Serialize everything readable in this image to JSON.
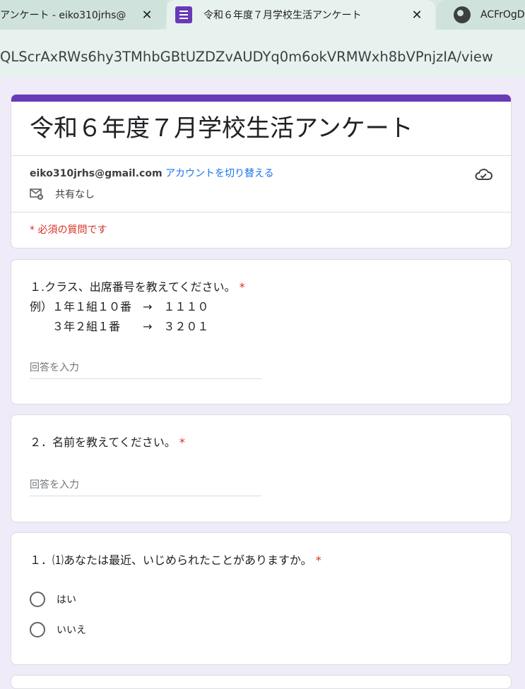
{
  "browser": {
    "tabs": [
      {
        "title": "アンケート - eiko310jrhs@",
        "close": "✕"
      },
      {
        "title": "令和６年度７月学校生活アンケート",
        "close": "✕"
      },
      {
        "title": "ACFrOgD"
      }
    ],
    "url": "QLScrAxRWs6hy3TMhbGBtUZDZvAUDYq0m6okVRMWxh8bVPnjzIA/view"
  },
  "form": {
    "title": "令和６年度７月学校生活アンケート",
    "account_email": "eiko310jrhs@gmail.com",
    "switch_account": "アカウントを切り替える",
    "share_status": "共有なし",
    "required_note": "* 必須の質問です",
    "accent_color": "#673ab7"
  },
  "questions": [
    {
      "title": "１.クラス、出席番号を教えてください。",
      "required_mark": "*",
      "description_line1": "例）１年１組１０番　→　１１１０",
      "description_line2": "　　３年２組１番　　→　３２０１",
      "placeholder": "回答を入力"
    },
    {
      "title": "２．名前を教えてください。",
      "required_mark": "*",
      "placeholder": "回答を入力"
    },
    {
      "title": "１．⑴あなたは最近、いじめられたことがありますか。",
      "required_mark": "*",
      "options": [
        "はい",
        "いいえ"
      ]
    }
  ]
}
